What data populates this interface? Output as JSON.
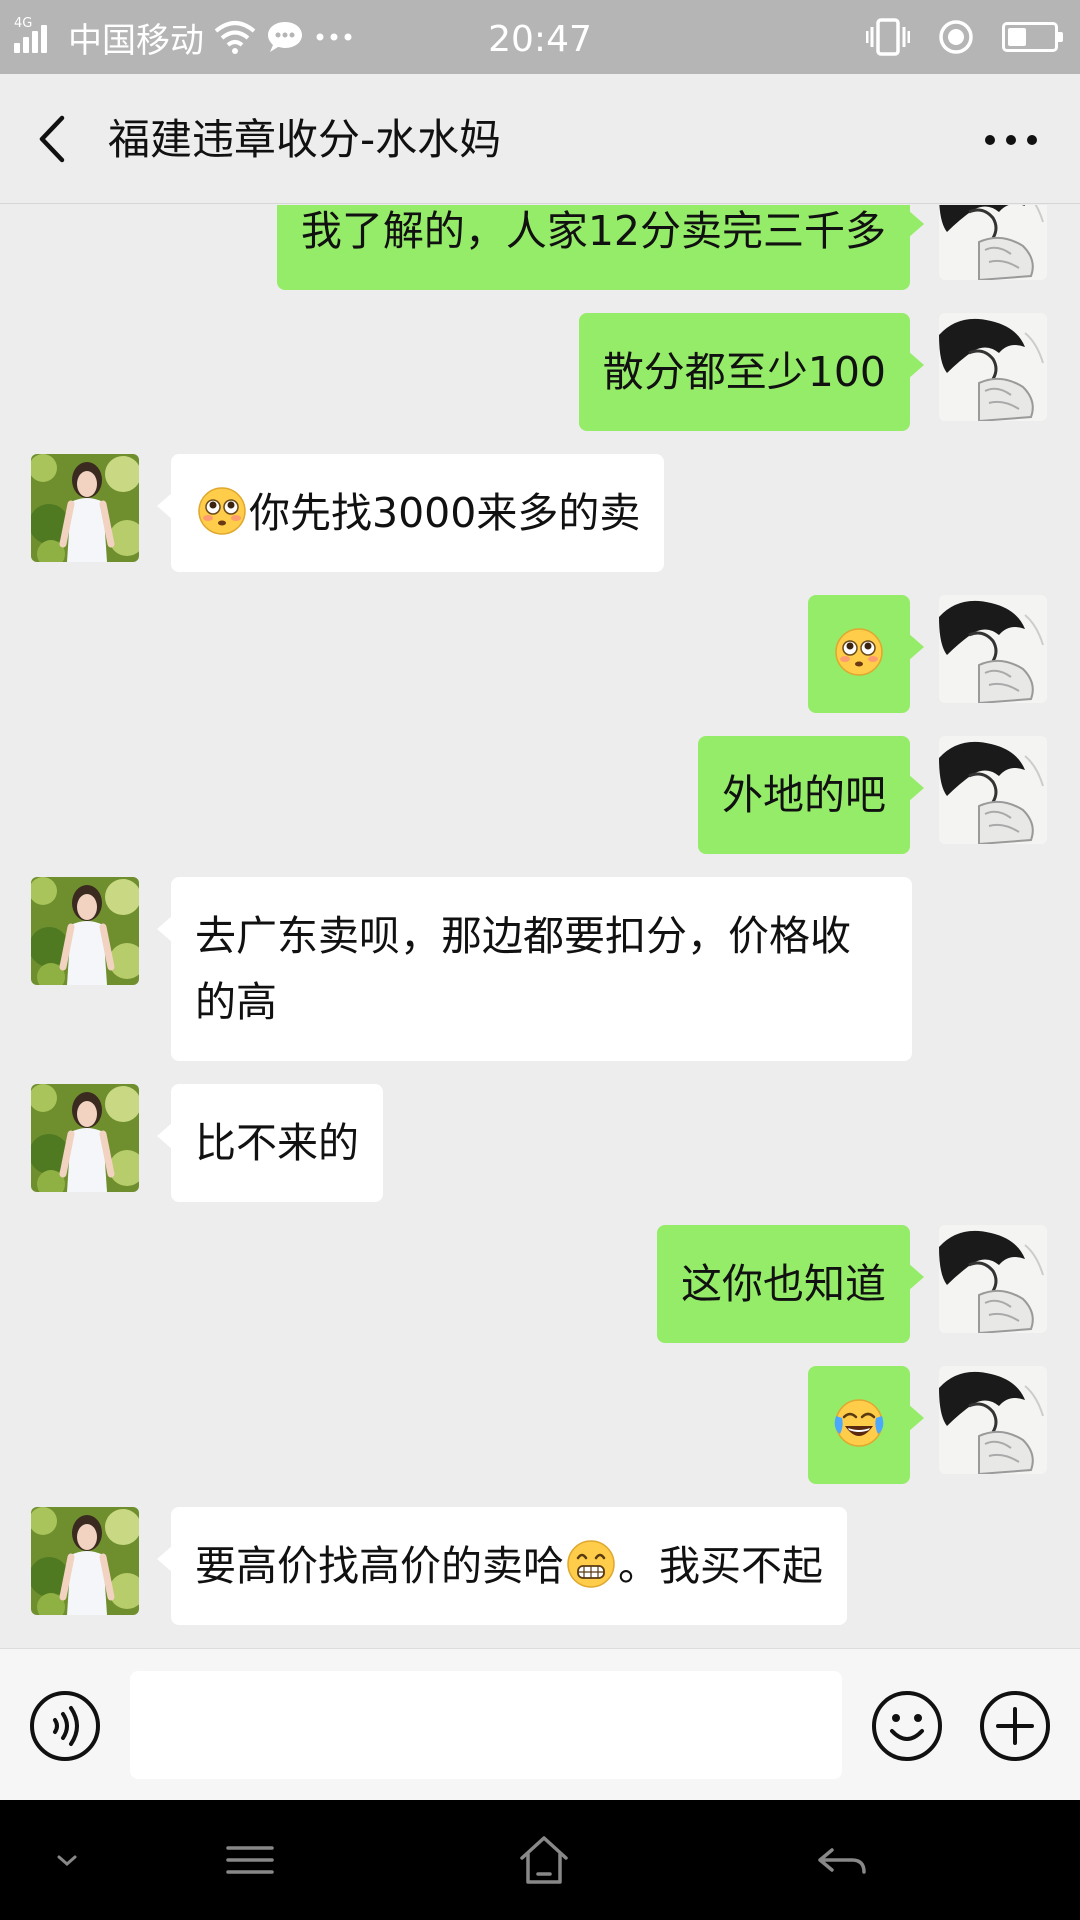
{
  "status_bar": {
    "network": "4G",
    "carrier": "中国移动",
    "time": "20:47",
    "battery_level": 0.35
  },
  "header": {
    "title": "福建违章收分-水水妈",
    "back_icon": "chevron-left-icon",
    "more_icon": "more-dots-icon"
  },
  "colors": {
    "sent_bubble": "#95ec69",
    "received_bubble": "#ffffff",
    "chat_background": "#ededed"
  },
  "messages": [
    {
      "side": "right",
      "text": "我了解的，人家12分卖完三千多"
    },
    {
      "side": "right",
      "text": "散分都至少100"
    },
    {
      "side": "left",
      "text": "你先找3000来多的卖",
      "emoji": "flushed-face-emoji"
    },
    {
      "side": "right",
      "emoji": "flushed-face-emoji"
    },
    {
      "side": "right",
      "text": "外地的吧"
    },
    {
      "side": "left",
      "text": "去广东卖呗，那边都要扣分，价格收的高"
    },
    {
      "side": "left",
      "text": "比不来的"
    },
    {
      "side": "right",
      "text": "这你也知道"
    },
    {
      "side": "right",
      "emoji": "crying-laughing-emoji"
    },
    {
      "side": "left",
      "text_before": "要高价找高价的卖哈",
      "text_after": "。我买不起",
      "emoji": "grinning-emoji"
    }
  ],
  "input": {
    "value": "",
    "voice_icon": "voice-icon",
    "emoji_icon": "smiley-icon",
    "plus_icon": "plus-icon"
  },
  "nav_bar": {
    "icons": [
      "chevron-down-icon",
      "menu-icon",
      "home-icon",
      "back-arrow-icon"
    ]
  }
}
